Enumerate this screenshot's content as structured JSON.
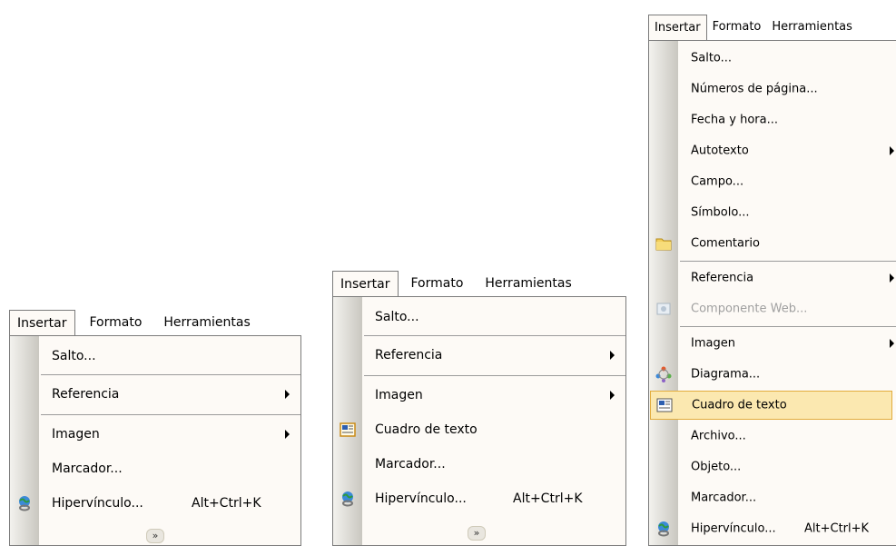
{
  "menu1": {
    "menubar": [
      "Insertar",
      "Formato",
      "Herramientas"
    ],
    "items": [
      {
        "label": "Salto..."
      },
      {
        "label": "Referencia"
      },
      {
        "label": "Imagen"
      },
      {
        "label": "Marcador..."
      },
      {
        "label": "Hipervínculo...",
        "shortcut": "Alt+Ctrl+K"
      }
    ]
  },
  "menu2": {
    "menubar": [
      "Insertar",
      "Formato",
      "Herramientas"
    ],
    "items": [
      {
        "label": "Salto..."
      },
      {
        "label": "Referencia"
      },
      {
        "label": "Imagen"
      },
      {
        "label": "Cuadro de texto"
      },
      {
        "label": "Marcador..."
      },
      {
        "label": "Hipervínculo...",
        "shortcut": "Alt+Ctrl+K"
      }
    ]
  },
  "menu3": {
    "menubar": [
      "Insertar",
      "Formato",
      "Herramientas"
    ],
    "items": [
      {
        "label": "Salto..."
      },
      {
        "label": "Números de página..."
      },
      {
        "label": "Fecha y hora..."
      },
      {
        "label": "Autotexto"
      },
      {
        "label": "Campo..."
      },
      {
        "label": "Símbolo..."
      },
      {
        "label": "Comentario"
      },
      {
        "label": "Referencia"
      },
      {
        "label": "Componente Web..."
      },
      {
        "label": "Imagen"
      },
      {
        "label": "Diagrama..."
      },
      {
        "label": "Cuadro de texto"
      },
      {
        "label": "Archivo..."
      },
      {
        "label": "Objeto..."
      },
      {
        "label": "Marcador..."
      },
      {
        "label": "Hipervínculo...",
        "shortcut": "Alt+Ctrl+K"
      }
    ]
  },
  "icons": {
    "expand": "double-chevron-down-icon",
    "hyperlink": "globe-link-icon",
    "textbox": "textbox-icon",
    "comment": "folder-comment-icon",
    "web_component": "web-component-icon",
    "diagram": "diagram-icon"
  },
  "colors": {
    "menu_bg": "#fdfaf6",
    "highlight": "#fbe8b0",
    "highlight_border": "#e2ac3c"
  }
}
